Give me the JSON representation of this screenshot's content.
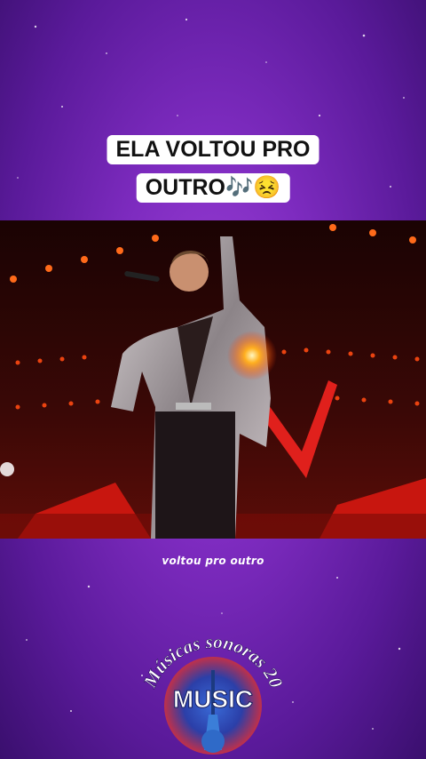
{
  "caption": {
    "line1": "ELA VOLTOU PRO",
    "line2": "OUTRO🎶😣"
  },
  "subtitle": "voltou pro outro",
  "logo": {
    "arc_text": "Músicas sonoras 20",
    "word": "MUSIC"
  },
  "colors": {
    "background": "#7d2bbf",
    "stage_red": "#e0201c",
    "caption_bg": "#ffffff"
  }
}
